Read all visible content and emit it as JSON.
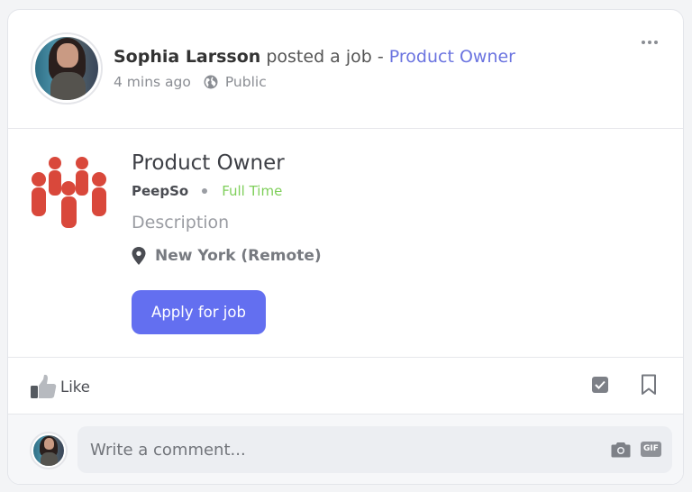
{
  "post": {
    "author": "Sophia Larsson",
    "action_text": " posted a job - ",
    "job_link": "Product Owner",
    "time": "4 mins ago",
    "privacy": "Public"
  },
  "job": {
    "title": "Product Owner",
    "company": "PeepSo",
    "type": "Full Time",
    "description_label": "Description",
    "location": "New York (Remote)",
    "apply_label": "Apply for job"
  },
  "actions": {
    "like_label": "Like"
  },
  "comment": {
    "placeholder": "Write a comment...",
    "gif_label": "GIF"
  },
  "colors": {
    "accent": "#636ff0",
    "link": "#6b74e0",
    "job_type": "#7fcf5a",
    "job_icon": "#d9483b"
  },
  "icons": [
    "more-options-icon",
    "globe-icon",
    "job-group-icon",
    "map-pin-icon",
    "thumbs-up-icon",
    "checkbox-icon",
    "bookmark-icon",
    "camera-icon",
    "gif-icon"
  ]
}
